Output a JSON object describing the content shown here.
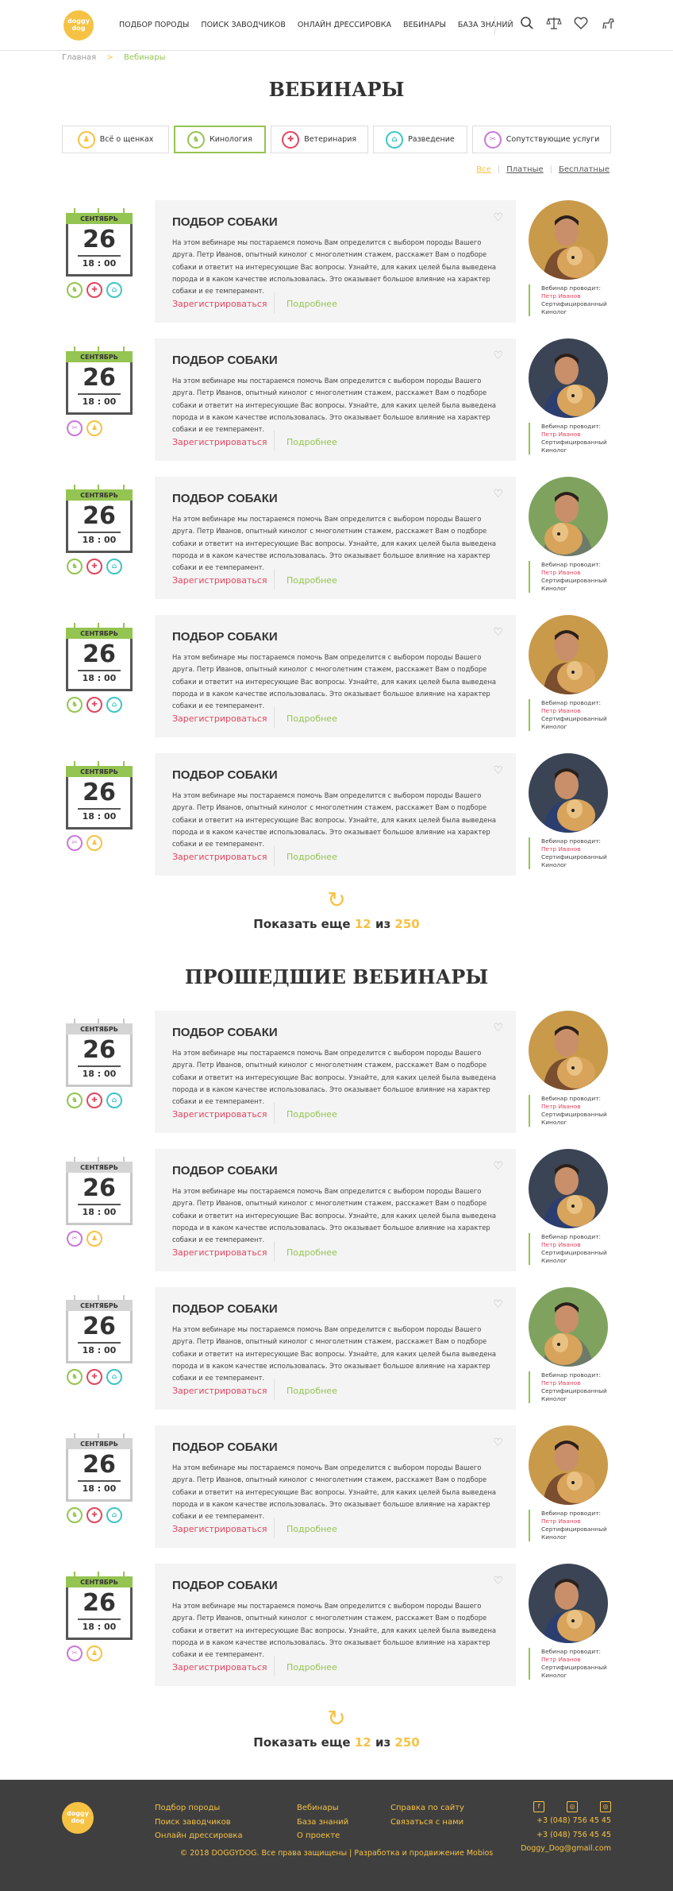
{
  "header": {
    "logo_text": "doggy dog",
    "nav": [
      "ПОДБОР ПОРОДЫ",
      "ПОИСК ЗАВОДЧИКОВ",
      "ОНЛАЙН ДРЕССИРОВКА",
      "ВЕБИНАРЫ",
      "БАЗА ЗНАНИЙ"
    ],
    "icons": [
      "search-icon",
      "scales-icon",
      "heart-icon",
      "dog-icon"
    ]
  },
  "breadcrumb": {
    "home": "Главная",
    "sep": ">",
    "current": "Вебинары"
  },
  "page_title": "ВЕБИНАРЫ",
  "categories": [
    {
      "label": "Всё о щенках",
      "color": "#f6c244",
      "icon": "puppy-icon",
      "glyph": "♟"
    },
    {
      "label": "Кинология",
      "color": "#94c451",
      "icon": "dog-training-icon",
      "glyph": "♞"
    },
    {
      "label": "Ветеринария",
      "color": "#e2465f",
      "icon": "vet-icon",
      "glyph": "✚"
    },
    {
      "label": "Разведение",
      "color": "#3ec4c6",
      "icon": "breeding-house-icon",
      "glyph": "⌂"
    },
    {
      "label": "Сопутствующие услуги",
      "color": "#c978d9",
      "icon": "services-icon",
      "glyph": "✂"
    }
  ],
  "filters": {
    "all": "Все",
    "paid": "Платные",
    "free": "Бесплатные",
    "sep": "|"
  },
  "webinar": {
    "title": "ПОДБОР СОБАКИ",
    "text": "На этом вебинаре мы постараемся помочь Вам определится с выбором породы Вашего друга. Петр Иванов, опытный кинолог с многолетним стажем, расскажет Вам о подборе собаки и ответит на интересующие Вас вопросы. Узнайте, для каких целей была выведена порода и в каком качестве использовалась. Это оказывает большое влияние на характер собаки и ее темперамент.",
    "register": "Зарегистрироваться",
    "details": "Подробнее",
    "month": "СЕНТЯБРЬ",
    "day": "26",
    "time": "18 : 00",
    "host_label": "Вебинар проводит:",
    "host_name": "Петр Иванов",
    "host_title": "Сертифицированный Кинолог"
  },
  "upcoming": [
    {
      "tags": [
        1,
        2,
        3
      ],
      "photo": "a"
    },
    {
      "tags": [
        4,
        0
      ],
      "photo": "b"
    },
    {
      "tags": [
        1,
        2,
        3
      ],
      "photo": "c"
    },
    {
      "tags": [
        1,
        2,
        3
      ],
      "photo": "a"
    },
    {
      "tags": [
        4,
        0
      ],
      "photo": "b"
    }
  ],
  "past": [
    {
      "tags": [
        1,
        2,
        3
      ],
      "photo": "a",
      "past": true
    },
    {
      "tags": [
        4,
        0
      ],
      "photo": "b",
      "past": true
    },
    {
      "tags": [
        1,
        2,
        3
      ],
      "photo": "c",
      "past": true
    },
    {
      "tags": [
        1,
        2,
        3
      ],
      "photo": "a",
      "past": true
    },
    {
      "tags": [
        4,
        0
      ],
      "photo": "b",
      "past": false
    }
  ],
  "load_more": {
    "prefix": "Показать еще",
    "count": "12",
    "mid": "из",
    "total": "250"
  },
  "past_title": "ПРОШЕДШИЕ ВЕБИНАРЫ",
  "footer": {
    "col1": [
      "Подбор породы",
      "Поиск заводчиков",
      "Онлайн дрессировка"
    ],
    "col2": [
      "Вебинары",
      "База знаний",
      "О проекте"
    ],
    "col3": [
      "Справка по сайту",
      "Связаться с нами"
    ],
    "phones": [
      "+3 (048) 756 45 45",
      "+3 (048) 756 45 45"
    ],
    "email": "Doggy_Dog@gmail.com",
    "social": [
      "facebook-icon",
      "instagram-icon",
      "instagram-icon"
    ],
    "copyright": "© 2018 DOGGYDOG. Все права защищены | Разработка и продвижение Mobios"
  },
  "colors": {
    "accent": "#f6c244",
    "green": "#94c451",
    "red": "#e2465f",
    "footer_bg": "#3f3f3f"
  }
}
